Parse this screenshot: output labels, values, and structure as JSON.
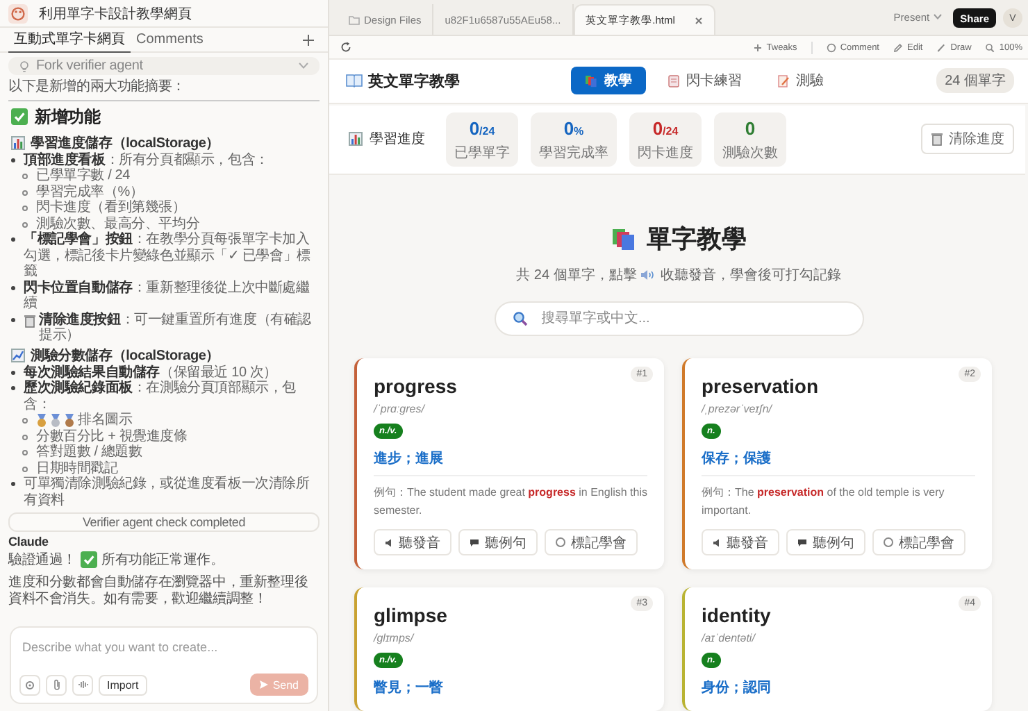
{
  "chat": {
    "title": "利用單字卡設計教學網頁",
    "tabs": [
      {
        "label": "互動式單字卡網頁",
        "selected": true
      },
      {
        "label": "Comments",
        "selected": false
      }
    ],
    "agent_select": "Fork verifier agent",
    "intro": "以下是新增的兩大功能摘要：",
    "heading": "新增功能",
    "sections": [
      {
        "title": "學習進度儲存（localStorage）",
        "items": [
          {
            "kind": "text",
            "text": "**頂部進度看板**：所有分頁都顯示，包含：",
            "children": [
              {
                "kind": "text",
                "text": "已學單字數 / 24"
              },
              {
                "kind": "text",
                "text": "學習完成率（%）"
              },
              {
                "kind": "text",
                "text": "閃卡進度（看到第幾張）"
              },
              {
                "kind": "text",
                "text": "測驗次數、最高分、平均分"
              }
            ]
          },
          {
            "kind": "text",
            "text": "**「標記學會」按鈕**：在教學分頁每張單字卡加入勾選，標記後卡片變綠色並顯示「✓ 已學會」標籤"
          },
          {
            "kind": "text",
            "text": "**閃卡位置自動儲存**：重新整理後從上次中斷處繼續"
          },
          {
            "kind": "trash",
            "text": "**清除進度按鈕**：可一鍵重置所有進度（有確認提示）"
          }
        ]
      },
      {
        "title": "測驗分數儲存（localStorage）",
        "items": [
          {
            "kind": "text",
            "text": "**每次測驗結果自動儲存**（保留最近 10 次）"
          },
          {
            "kind": "text",
            "text": "**歷次測驗紀錄面板**：在測驗分頁頂部顯示，包含：",
            "children": [
              {
                "kind": "medals",
                "text": "排名圖示"
              },
              {
                "kind": "text",
                "text": "分數百分比 + 視覺進度條"
              },
              {
                "kind": "text",
                "text": "答對題數 / 總題數"
              },
              {
                "kind": "text",
                "text": "日期時間戳記"
              }
            ]
          },
          {
            "kind": "text",
            "text": "可單獨清除測驗紀錄，或從進度看板一次清除所有資料"
          }
        ]
      }
    ],
    "status": "Verifier agent check completed",
    "author": "Claude",
    "reply_before": "驗證通過！",
    "reply_after": "所有功能正常運作。",
    "message": "進度和分數都會自動儲存在瀏覽器中，重新整理後資料不會消失。如有需要，歡迎繼續調整！",
    "composer": {
      "placeholder": "Describe what you want to create...",
      "import": "Import",
      "send": "Send"
    }
  },
  "file_tabs": [
    {
      "label": "Design Files",
      "kind": "folder",
      "selected": false
    },
    {
      "label": "u82F1u6587u55AEu58...",
      "kind": "page",
      "selected": false
    },
    {
      "label": "英文單字教學.html",
      "kind": "page",
      "selected": true
    }
  ],
  "present": "Present",
  "share": "Share",
  "avatar": "V",
  "toolbar": [
    {
      "label": "Tweaks",
      "kind": "plus"
    },
    {
      "label": "Comment",
      "kind": "comment"
    },
    {
      "label": "Edit",
      "kind": "edit"
    },
    {
      "label": "Draw",
      "kind": "draw"
    },
    {
      "label": "100%",
      "kind": "zoom"
    }
  ],
  "app": {
    "title": "英文單字教學",
    "nav": [
      {
        "label": "教學",
        "kind": "books",
        "selected": true
      },
      {
        "label": "閃卡練習",
        "kind": "cards",
        "selected": false
      },
      {
        "label": "測驗",
        "kind": "memo",
        "selected": false
      }
    ],
    "word_count": "24 個單字",
    "progress": {
      "label": "學習進度",
      "stats": [
        {
          "value": "0",
          "unit": "/24",
          "label": "已學單字",
          "color": "#1565c0"
        },
        {
          "value": "0",
          "unit": "%",
          "label": "學習完成率",
          "color": "#1565c0"
        },
        {
          "value": "0",
          "unit": "/24",
          "label": "閃卡進度",
          "color": "#c62828"
        },
        {
          "value": "0",
          "label": "測驗次數",
          "color": "#2e7d32"
        }
      ],
      "clear": "清除進度"
    },
    "hero": {
      "title": "單字教學",
      "subtitle_before": "共 24 個單字，點擊",
      "subtitle_after": "收聽發音，學會後可打勾記錄",
      "search_placeholder": "搜尋單字或中文..."
    },
    "cards": [
      {
        "number": "#1",
        "word": "progress",
        "phonetic": "/ˈprɑːɡres/",
        "pos": "n./v.",
        "translation": "進步；進展",
        "example": "例句：The student made great **progress** in English this semester.",
        "color": "#c4613a",
        "learned": false,
        "buttons": [
          "聽發音",
          "聽例句",
          "標記學會"
        ]
      },
      {
        "number": "#2",
        "word": "preservation",
        "phonetic": "/ˌprezərˈveɪʃn/",
        "pos": "n.",
        "translation": "保存；保護",
        "example": "例句：The **preservation** of the old temple is very important.",
        "color": "#d07a2a",
        "learned": false,
        "buttons": [
          "聽發音",
          "聽例句",
          "標記學會"
        ]
      },
      {
        "number": "#3",
        "word": "glimpse",
        "phonetic": "/ɡlɪmps/",
        "pos": "n./v.",
        "translation": "瞥見；一瞥",
        "color": "#c9a232"
      },
      {
        "number": "#4",
        "word": "identity",
        "phonetic": "/aɪˈdentəti/",
        "pos": "n.",
        "translation": "身份；認同",
        "color": "#b9b332"
      }
    ]
  }
}
